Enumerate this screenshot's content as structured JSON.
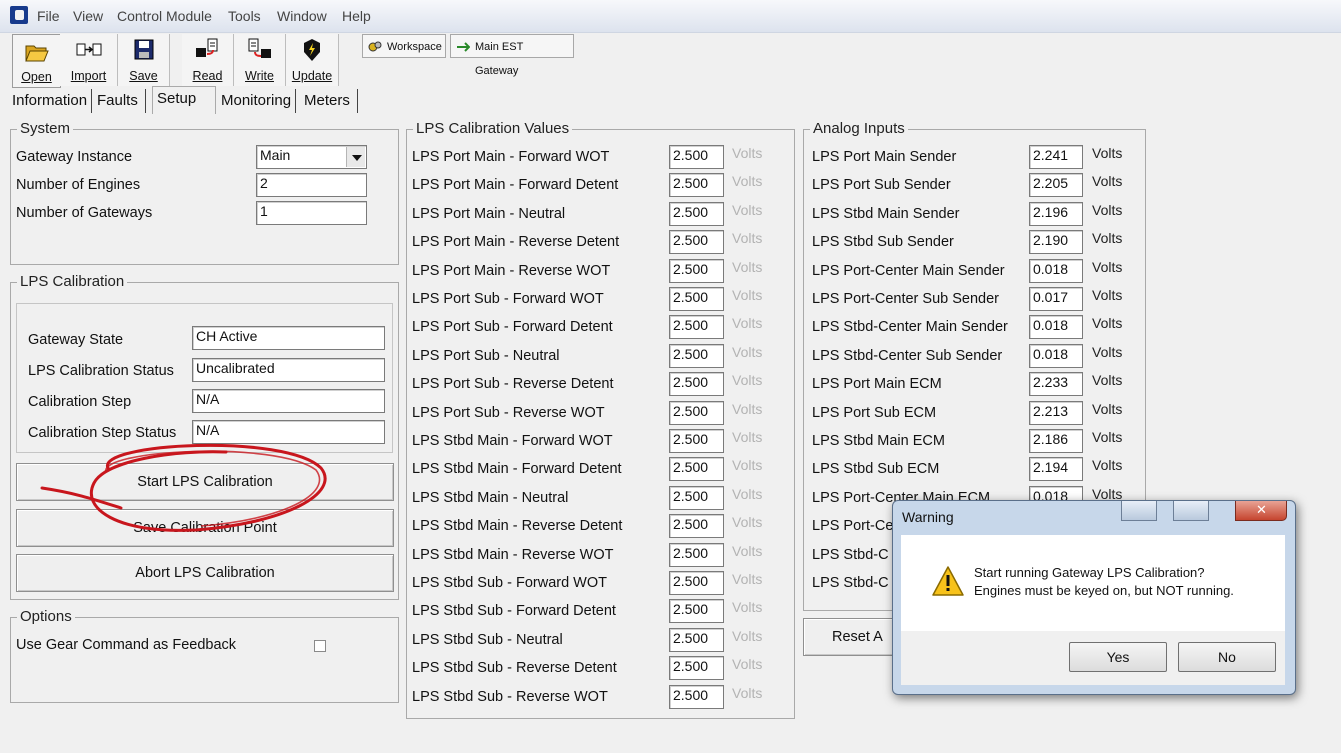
{
  "menu": [
    "File",
    "View",
    "Control Module",
    "Tools",
    "Window",
    "Help"
  ],
  "toolbar": {
    "open": "Open",
    "import": "Import",
    "save": "Save",
    "read": "Read",
    "write": "Write",
    "update": "Update",
    "workspace": "Workspace",
    "gateway": "Main EST Gateway"
  },
  "tabs": [
    "Information",
    "Faults",
    "Setup",
    "Monitoring",
    "Meters"
  ],
  "system": {
    "title": "System",
    "rows": [
      {
        "label": "Gateway Instance",
        "value": "Main"
      },
      {
        "label": "Number of Engines",
        "value": "2"
      },
      {
        "label": "Number of Gateways",
        "value": "1"
      }
    ]
  },
  "lps_cal": {
    "title": "LPS Calibration",
    "rows": [
      {
        "label": "Gateway State",
        "value": "CH Active"
      },
      {
        "label": "LPS Calibration Status",
        "value": "Uncalibrated"
      },
      {
        "label": "Calibration Step",
        "value": "N/A"
      },
      {
        "label": "Calibration Step Status",
        "value": "N/A"
      }
    ],
    "start_btn": "Start LPS Calibration",
    "save_btn": "Save Calibration Point",
    "abort_btn": "Abort LPS Calibration"
  },
  "options": {
    "title": "Options",
    "gear_label": "Use Gear Command as Feedback"
  },
  "lps_values": {
    "title": "LPS Calibration Values",
    "unit": "Volts",
    "rows": [
      {
        "label": "LPS Port Main - Forward WOT",
        "value": "2.500"
      },
      {
        "label": "LPS Port Main - Forward Detent",
        "value": "2.500"
      },
      {
        "label": "LPS Port Main - Neutral",
        "value": "2.500"
      },
      {
        "label": "LPS Port Main - Reverse Detent",
        "value": "2.500"
      },
      {
        "label": "LPS Port Main - Reverse WOT",
        "value": "2.500"
      },
      {
        "label": "LPS Port Sub - Forward WOT",
        "value": "2.500"
      },
      {
        "label": "LPS Port Sub - Forward Detent",
        "value": "2.500"
      },
      {
        "label": "LPS Port Sub - Neutral",
        "value": "2.500"
      },
      {
        "label": "LPS Port Sub - Reverse Detent",
        "value": "2.500"
      },
      {
        "label": "LPS Port Sub - Reverse WOT",
        "value": "2.500"
      },
      {
        "label": "LPS Stbd Main - Forward WOT",
        "value": "2.500"
      },
      {
        "label": "LPS Stbd Main - Forward Detent",
        "value": "2.500"
      },
      {
        "label": "LPS Stbd Main - Neutral",
        "value": "2.500"
      },
      {
        "label": "LPS Stbd Main - Reverse Detent",
        "value": "2.500"
      },
      {
        "label": "LPS Stbd Main - Reverse WOT",
        "value": "2.500"
      },
      {
        "label": "LPS Stbd Sub - Forward WOT",
        "value": "2.500"
      },
      {
        "label": "LPS Stbd Sub - Forward Detent",
        "value": "2.500"
      },
      {
        "label": "LPS Stbd Sub - Neutral",
        "value": "2.500"
      },
      {
        "label": "LPS Stbd Sub - Reverse Detent",
        "value": "2.500"
      },
      {
        "label": "LPS Stbd Sub - Reverse WOT",
        "value": "2.500"
      }
    ]
  },
  "analog": {
    "title": "Analog Inputs",
    "unit": "Volts",
    "rows": [
      {
        "label": "LPS Port Main Sender",
        "value": "2.241"
      },
      {
        "label": "LPS Port Sub Sender",
        "value": "2.205"
      },
      {
        "label": "LPS Stbd Main Sender",
        "value": "2.196"
      },
      {
        "label": "LPS Stbd Sub Sender",
        "value": "2.190"
      },
      {
        "label": "LPS Port-Center Main Sender",
        "value": "0.018"
      },
      {
        "label": "LPS Port-Center Sub Sender",
        "value": "0.017"
      },
      {
        "label": "LPS Stbd-Center Main Sender",
        "value": "0.018"
      },
      {
        "label": "LPS Stbd-Center Sub Sender",
        "value": "0.018"
      },
      {
        "label": "LPS Port Main ECM",
        "value": "2.233"
      },
      {
        "label": "LPS Port Sub ECM",
        "value": "2.213"
      },
      {
        "label": "LPS Stbd Main ECM",
        "value": "2.186"
      },
      {
        "label": "LPS Stbd Sub ECM",
        "value": "2.194"
      },
      {
        "label": "LPS Port-Center Main ECM",
        "value": "0.018"
      },
      {
        "label": "LPS Port-Ce",
        "value": ""
      },
      {
        "label": "LPS Stbd-C",
        "value": ""
      },
      {
        "label": "LPS Stbd-C",
        "value": ""
      }
    ],
    "reset_btn": "Reset A"
  },
  "dialog": {
    "title": "Warning",
    "line1": "Start running Gateway LPS Calibration?",
    "line2": "Engines must be keyed on, but NOT running.",
    "yes": "Yes",
    "no": "No"
  },
  "colors": {
    "annotation": "#c8161d"
  }
}
